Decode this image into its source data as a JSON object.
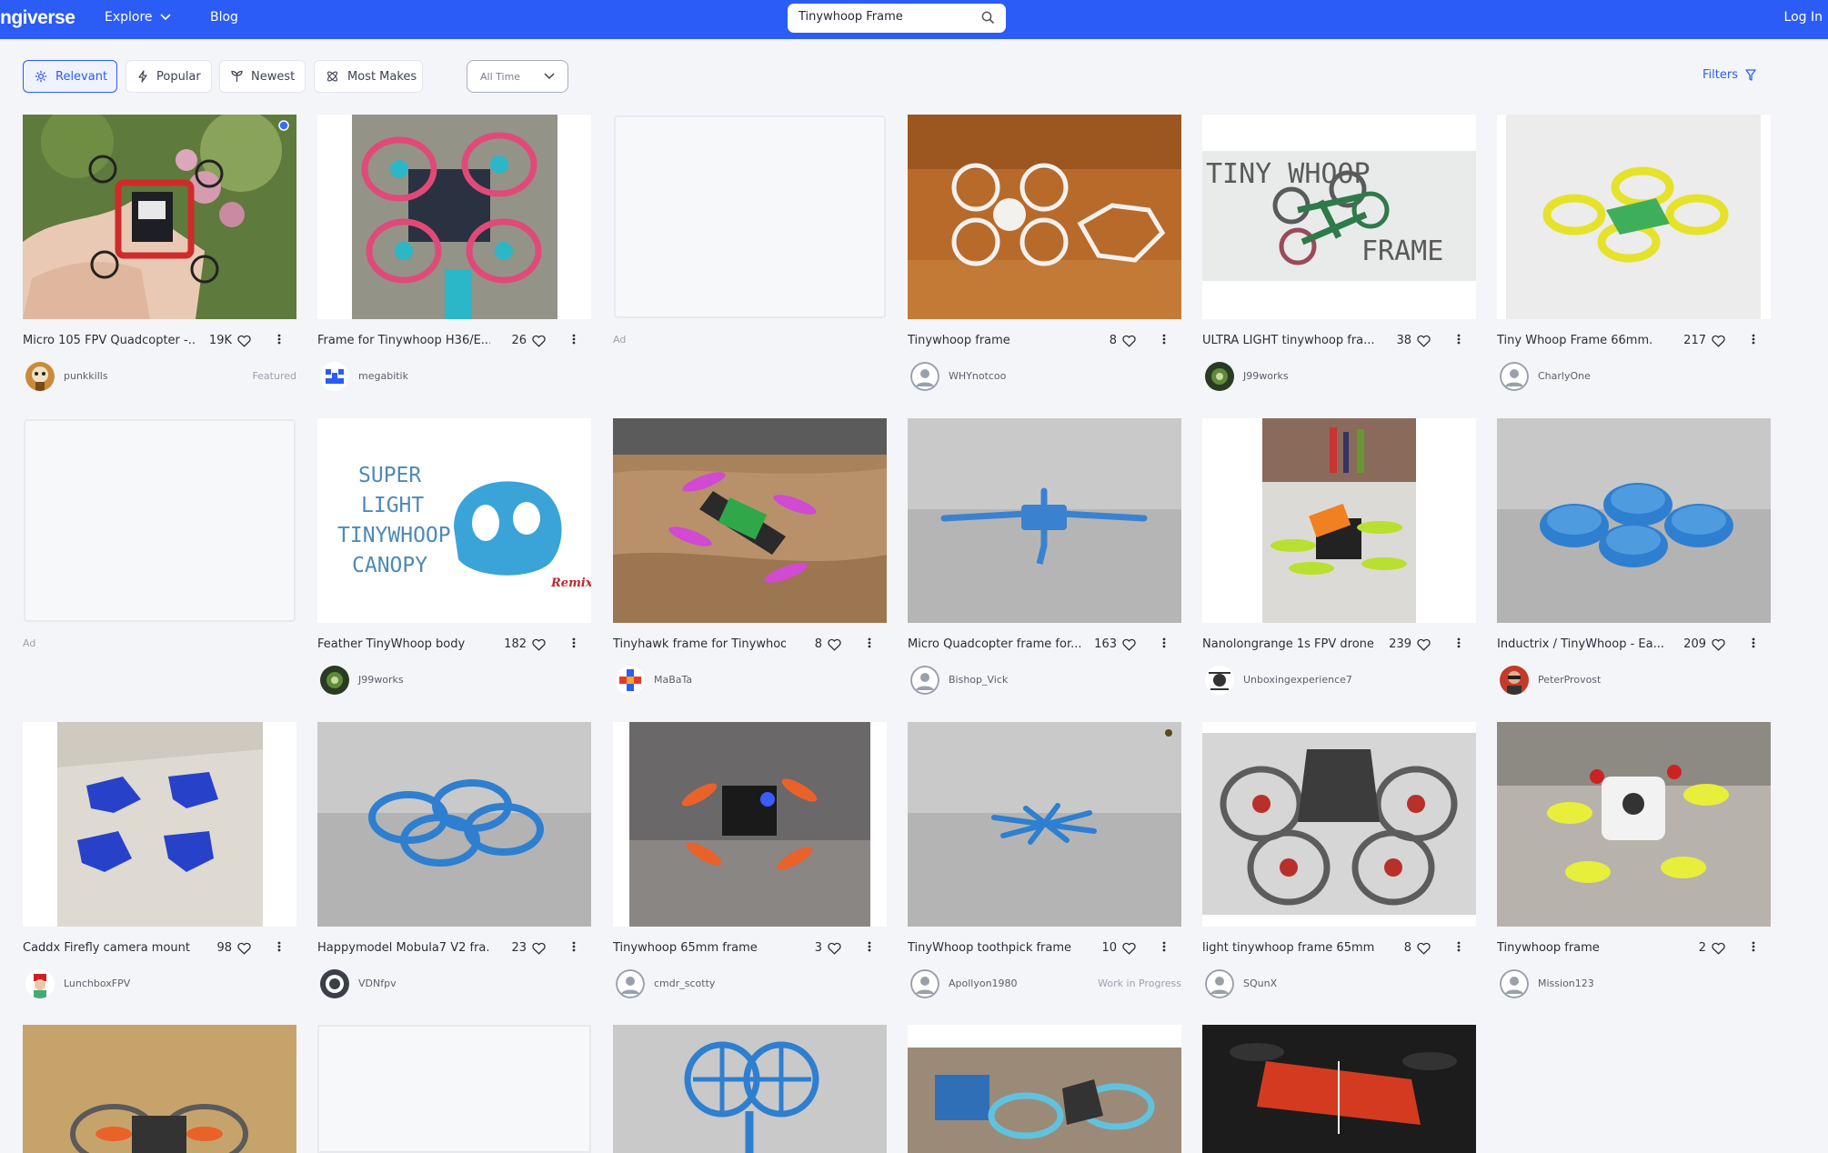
{
  "header": {
    "logo": "ngiverse",
    "explore": "Explore",
    "blog": "Blog",
    "search_value": "Tinywhoop Frame",
    "login": "Log In"
  },
  "sort": {
    "relevant": "Relevant",
    "popular": "Popular",
    "newest": "Newest",
    "most_makes": "Most Makes",
    "time": "All Time",
    "filters": "Filters"
  },
  "colors": {
    "brand": "#2b5cf6"
  },
  "ad_label": "Ad",
  "cards": [
    {
      "title": "Micro 105 FPV Quadcopter -...",
      "likes": "19K",
      "user": "punkkills",
      "tag": "Featured"
    },
    {
      "title": "Frame for Tinywhoop H36/E...",
      "likes": "26",
      "user": "megabitik",
      "tag": ""
    },
    {
      "title": "",
      "likes": "",
      "user": "",
      "tag": ""
    },
    {
      "title": "Tinywhoop frame",
      "likes": "8",
      "user": "WHYnotcoo",
      "tag": ""
    },
    {
      "title": "ULTRA LIGHT tinywhoop fra...",
      "likes": "38",
      "user": "J99works",
      "tag": "",
      "image_text": {
        "top": "TINY WHOOP",
        "bottom": "FRAME"
      }
    },
    {
      "title": "Tiny Whoop Frame 66mm.",
      "likes": "217",
      "user": "CharlyOne",
      "tag": ""
    },
    {
      "title": "",
      "likes": "",
      "user": "",
      "tag": ""
    },
    {
      "title": "Feather TinyWhoop body",
      "likes": "182",
      "user": "J99works",
      "tag": "",
      "image_text": {
        "l1": "SUPER",
        "l2": "LIGHT",
        "l3": "TINYWHOOP",
        "l4": "CANOPY",
        "remix": "Remix"
      }
    },
    {
      "title": "Tinyhawk frame for Tinywhoop",
      "likes": "8",
      "user": "MaBaTa",
      "tag": ""
    },
    {
      "title": "Micro Quadcopter frame for...",
      "likes": "163",
      "user": "Bishop_Vick",
      "tag": ""
    },
    {
      "title": "Nanolongrange 1s FPV drone",
      "likes": "239",
      "user": "Unboxingexperience7",
      "tag": ""
    },
    {
      "title": "Inductrix / TinyWhoop - Ea...",
      "likes": "209",
      "user": "PeterProvost",
      "tag": ""
    },
    {
      "title": "Caddx Firefly camera mount",
      "likes": "98",
      "user": "LunchboxFPV",
      "tag": ""
    },
    {
      "title": "Happymodel Mobula7 V2 fra...",
      "likes": "23",
      "user": "VDNfpv",
      "tag": ""
    },
    {
      "title": "Tinywhoop 65mm frame",
      "likes": "3",
      "user": "cmdr_scotty",
      "tag": ""
    },
    {
      "title": "TinyWhoop toothpick frame",
      "likes": "10",
      "user": "Apollyon1980",
      "tag": "Work in Progress"
    },
    {
      "title": "light tinywhoop frame 65mm",
      "likes": "8",
      "user": "SQunX",
      "tag": ""
    },
    {
      "title": "Tinywhoop frame",
      "likes": "2",
      "user": "Mission123",
      "tag": ""
    }
  ]
}
